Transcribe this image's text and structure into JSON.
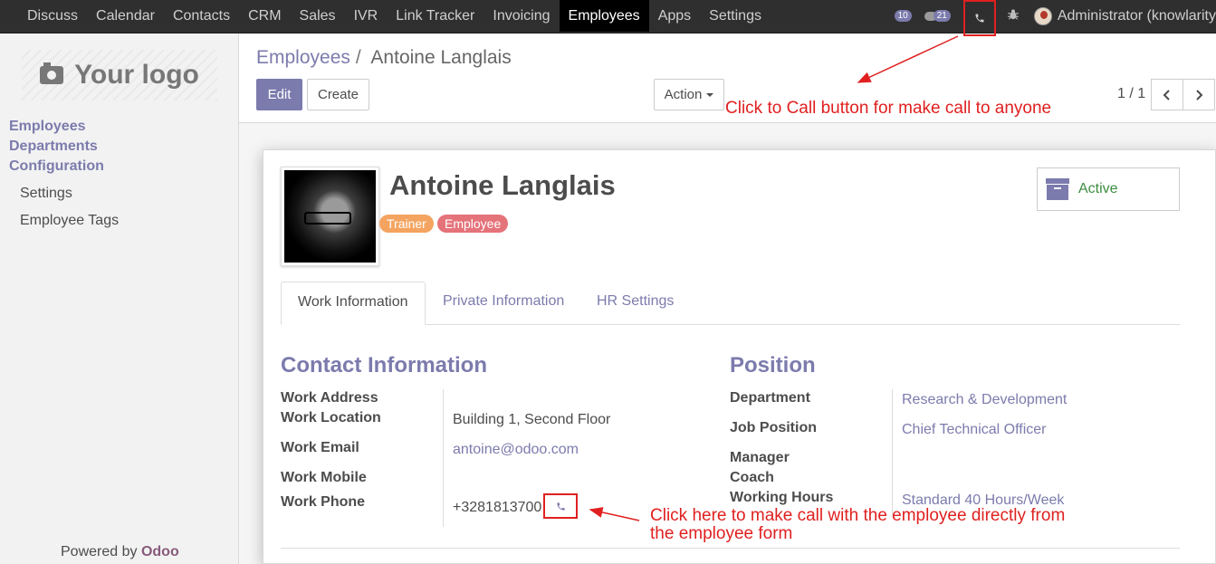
{
  "topbar": {
    "menu": [
      "Discuss",
      "Calendar",
      "Contacts",
      "CRM",
      "Sales",
      "IVR",
      "Link Tracker",
      "Invoicing",
      "Employees",
      "Apps",
      "Settings"
    ],
    "active_menu": "Employees",
    "activity_count": "10",
    "messages_count": "21",
    "user_name": "Administrator (knowlarity"
  },
  "sidebar": {
    "logo_text": "Your logo",
    "sections": [
      "Employees",
      "Departments",
      "Configuration"
    ],
    "config_items": [
      "Settings",
      "Employee Tags"
    ],
    "powered_prefix": "Powered by",
    "powered_brand": "Odoo"
  },
  "control_panel": {
    "breadcrumb_parent": "Employees",
    "breadcrumb_separator": "/",
    "breadcrumb_current": "Antoine Langlais",
    "edit_label": "Edit",
    "create_label": "Create",
    "action_label": "Action",
    "pager": "1 / 1"
  },
  "employee": {
    "name": "Antoine Langlais",
    "tags": [
      "Trainer",
      "Employee"
    ],
    "status_label": "Active"
  },
  "tabs": [
    "Work Information",
    "Private Information",
    "HR Settings"
  ],
  "contact": {
    "title": "Contact Information",
    "work_address_label": "Work Address",
    "work_location_label": "Work Location",
    "work_location_value": "Building 1, Second Floor",
    "work_email_label": "Work Email",
    "work_email_value": "antoine@odoo.com",
    "work_mobile_label": "Work Mobile",
    "work_phone_label": "Work Phone",
    "work_phone_value": "+3281813700"
  },
  "position": {
    "title": "Position",
    "department_label": "Department",
    "department_value": "Research & Development",
    "job_label": "Job Position",
    "job_value": "Chief Technical Officer",
    "manager_label": "Manager",
    "coach_label": "Coach",
    "hours_label": "Working Hours",
    "hours_value": "Standard 40 Hours/Week"
  },
  "annotations": {
    "top": "Click to Call button for make call to anyone",
    "bottom_line1": "Click here to make call with the employee directly from",
    "bottom_line2": "the employee form"
  },
  "colors": {
    "accent": "#7c7bad",
    "annotation": "#e02020",
    "topbar": "#2f2f2f",
    "tag_trainer": "#f4a460",
    "tag_employee": "#e5737a"
  }
}
